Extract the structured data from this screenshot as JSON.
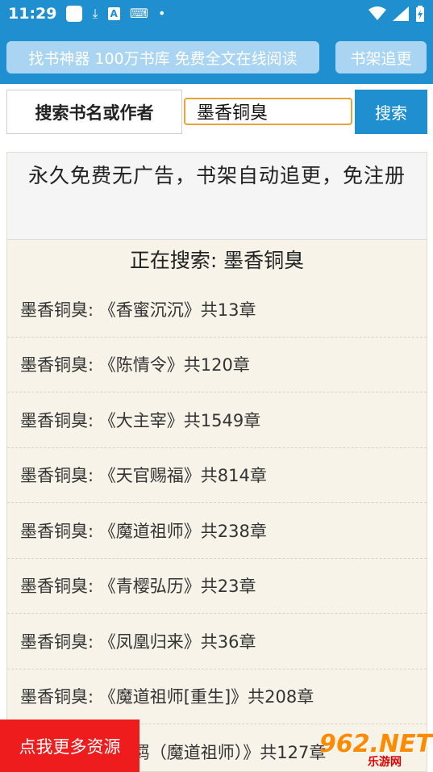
{
  "status_bar": {
    "time": "11:29",
    "icons_left": [
      "app-icon",
      "download-icon",
      "a-icon",
      "keyboard-icon",
      "dot-icon"
    ],
    "icons_right": [
      "wifi-icon",
      "signal-icon",
      "battery-icon"
    ]
  },
  "top_bar": {
    "banner_label": "找书神器 100万书库 免费全文在线阅读",
    "shelf_label": "书架追更"
  },
  "search": {
    "label": "搜索书名或作者",
    "value": "墨香铜臭",
    "button_label": "搜索"
  },
  "notice": {
    "text": "永久免费无广告，书架自动追更，免注册"
  },
  "searching": {
    "text": "正在搜索: 墨香铜臭"
  },
  "results": [
    {
      "text": "墨香铜臭: 《香蜜沉沉》共13章"
    },
    {
      "text": "墨香铜臭: 《陈情令》共120章"
    },
    {
      "text": "墨香铜臭: 《大主宰》共1549章"
    },
    {
      "text": "墨香铜臭: 《天官赐福》共814章"
    },
    {
      "text": "墨香铜臭: 《魔道祖师》共238章"
    },
    {
      "text": "墨香铜臭: 《青樱弘历》共23章"
    },
    {
      "text": "墨香铜臭: 《凤凰归来》共36章"
    },
    {
      "text": "墨香铜臭: 《魔道祖师[重生]》共208章"
    },
    {
      "text": "墨香铜臭: 《无羁（魔道祖师）》共127章"
    }
  ],
  "promo": {
    "label": "点我更多资源"
  },
  "watermark": {
    "main": "962.NET",
    "sub": "乐游网"
  }
}
